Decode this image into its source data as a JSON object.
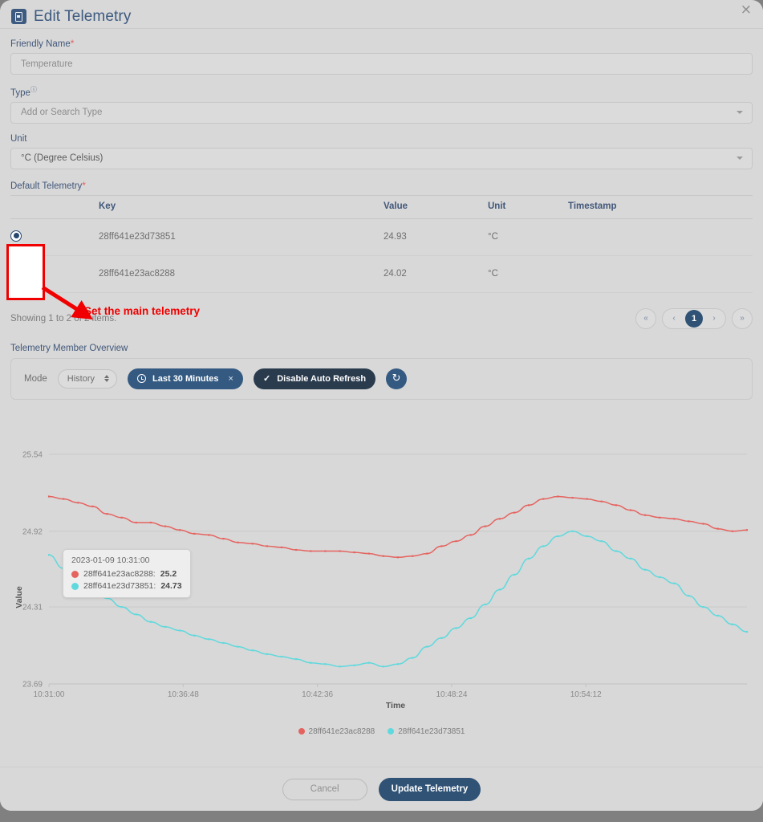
{
  "dialog": {
    "title": "Edit Telemetry",
    "title_icon": "device-icon",
    "close_label": "×"
  },
  "form": {
    "friendly_name": {
      "label": "Friendly Name",
      "required_marker": "*",
      "value": "Temperature",
      "placeholder": "Temperature"
    },
    "type": {
      "label": "Type",
      "sup": "ⓘ",
      "value": "",
      "placeholder": "Add or Search Type"
    },
    "unit": {
      "label": "Unit",
      "value": "°C (Degree Celsius)"
    }
  },
  "default_telemetry": {
    "label": "Default Telemetry",
    "required_marker": "*",
    "columns": [
      "",
      "Key",
      "Value",
      "Unit",
      "Timestamp"
    ],
    "rows": [
      {
        "selected": true,
        "key": "28ff641e23d73851",
        "value": "24.93",
        "unit": "°C",
        "timestamp": ""
      },
      {
        "selected": false,
        "key": "28ff641e23ac8288",
        "value": "24.02",
        "unit": "°C",
        "timestamp": ""
      }
    ],
    "showing_text": "Showing 1 to 2 of 2 items.",
    "pager": {
      "first": "«",
      "prev": "‹",
      "current": "1",
      "next": "›",
      "last": "»"
    }
  },
  "annotation": {
    "text": "Set the main telemetry",
    "color": "#f00000"
  },
  "overview": {
    "label": "Telemetry Member Overview",
    "mode_label": "Mode",
    "mode_value": "History",
    "range_pill": {
      "label": "Last 30 Minutes",
      "clear": "×",
      "icon": "clock-icon"
    },
    "refresh_pill": {
      "label": "Disable Auto Refresh",
      "check": "✓"
    },
    "reload_icon": "↻"
  },
  "tooltip": {
    "time": "2023-01-09 10:31:00",
    "rows": [
      {
        "name": "28ff641e23ac8288",
        "value": "25.2",
        "color": "#e5635f"
      },
      {
        "name": "28ff641e23d73851",
        "value": "24.73",
        "color": "#5fd9dd"
      }
    ]
  },
  "footer": {
    "cancel": "Cancel",
    "update": "Update Telemetry"
  },
  "chart_data": {
    "type": "line",
    "title": "",
    "xlabel": "Time",
    "ylabel": "Value",
    "grid": true,
    "legend_position": "bottom",
    "ylim": [
      23.69,
      25.85
    ],
    "yticks": [
      23.69,
      24.31,
      24.92,
      25.54
    ],
    "xticks": [
      "10:31:00",
      "10:36:48",
      "10:42:36",
      "10:48:24",
      "10:54:12"
    ],
    "x_range": [
      "10:31:00",
      "10:57:00"
    ],
    "colors": {
      "28ff641e23ac8288": "#e5635f",
      "28ff641e23d73851": "#5fd9dd"
    },
    "series": [
      {
        "name": "28ff641e23ac8288",
        "color": "#e5635f",
        "values": [
          25.2,
          25.18,
          25.15,
          25.12,
          25.06,
          25.03,
          24.99,
          24.99,
          24.96,
          24.93,
          24.9,
          24.89,
          24.86,
          24.83,
          24.82,
          24.8,
          24.79,
          24.77,
          24.76,
          24.76,
          24.76,
          24.75,
          24.74,
          24.72,
          24.71,
          24.72,
          24.74,
          24.8,
          24.84,
          24.89,
          24.96,
          25.02,
          25.07,
          25.13,
          25.18,
          25.2,
          25.19,
          25.18,
          25.16,
          25.13,
          25.09,
          25.05,
          25.03,
          25.02,
          25.0,
          24.98,
          24.94,
          24.92,
          24.93
        ]
      },
      {
        "name": "28ff641e23d73851",
        "color": "#5fd9dd",
        "values": [
          24.73,
          24.62,
          24.52,
          24.44,
          24.38,
          24.31,
          24.25,
          24.19,
          24.15,
          24.12,
          24.08,
          24.05,
          24.02,
          23.99,
          23.96,
          23.93,
          23.91,
          23.89,
          23.86,
          23.85,
          23.83,
          23.84,
          23.86,
          23.83,
          23.85,
          23.9,
          23.99,
          24.06,
          24.14,
          24.22,
          24.33,
          24.45,
          24.57,
          24.7,
          24.8,
          24.88,
          24.92,
          24.88,
          24.84,
          24.76,
          24.7,
          24.61,
          24.55,
          24.5,
          24.4,
          24.31,
          24.24,
          24.17,
          24.11
        ]
      }
    ]
  }
}
